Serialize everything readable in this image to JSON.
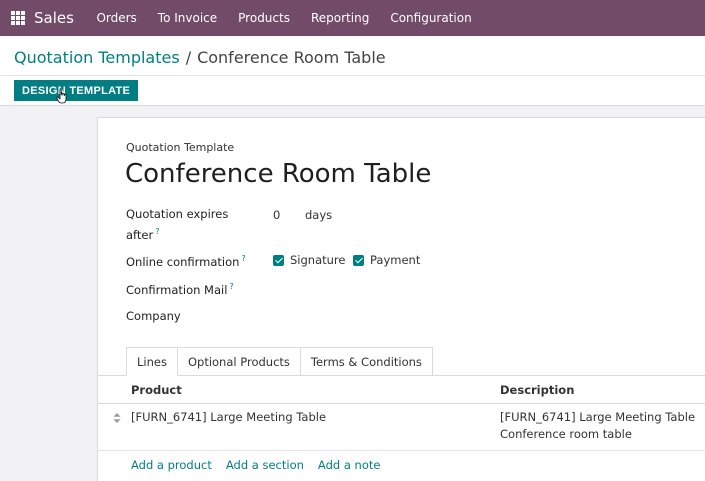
{
  "topbar": {
    "app_name": "Sales",
    "menu": [
      "Orders",
      "To Invoice",
      "Products",
      "Reporting",
      "Configuration"
    ]
  },
  "breadcrumb": {
    "parent": "Quotation Templates",
    "separator": "/",
    "current": "Conference Room Table"
  },
  "actions": {
    "design_template": "DESIGN TEMPLATE"
  },
  "form": {
    "label": "Quotation Template",
    "title": "Conference Room Table",
    "expires_label_1": "Quotation expires",
    "expires_label_2": "after",
    "expires_value": "0",
    "expires_unit": "days",
    "online_confirmation_label": "Online confirmation",
    "signature_label": "Signature",
    "signature_checked": true,
    "payment_label": "Payment",
    "payment_checked": true,
    "confirmation_mail_label": "Confirmation Mail",
    "company_label": "Company",
    "help_mark": "?"
  },
  "tabs": [
    "Lines",
    "Optional Products",
    "Terms & Conditions"
  ],
  "table": {
    "headers": [
      "Product",
      "Description"
    ],
    "rows": [
      {
        "product": "[FURN_6741] Large Meeting Table",
        "description_line1": "[FURN_6741] Large Meeting Table",
        "description_line2": "Conference room table"
      }
    ],
    "add_links": [
      "Add a product",
      "Add a section",
      "Add a note"
    ]
  },
  "colors": {
    "topbar": "#714b67",
    "accent": "#017e84"
  }
}
